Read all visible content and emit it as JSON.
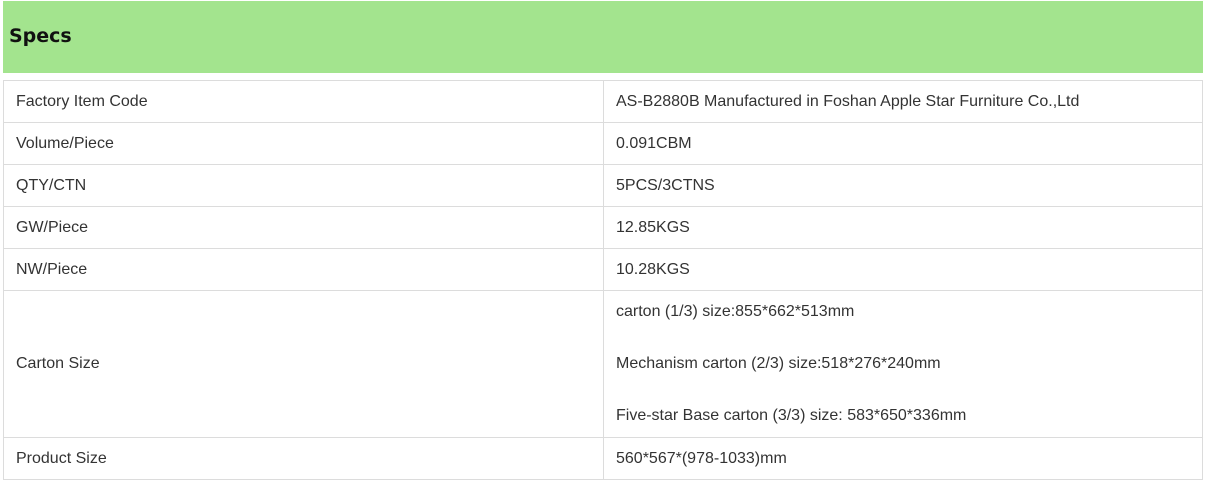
{
  "section": {
    "title": "Specs",
    "header_color": "#a3e48e"
  },
  "specs": [
    {
      "label": "Factory Item Code",
      "values": [
        "AS-B2880B  Manufactured in Foshan Apple Star Furniture Co.,Ltd"
      ]
    },
    {
      "label": "Volume/Piece",
      "values": [
        "0.091CBM"
      ]
    },
    {
      "label": "QTY/CTN",
      "values": [
        "5PCS/3CTNS"
      ]
    },
    {
      "label": "GW/Piece",
      "values": [
        "12.85KGS"
      ]
    },
    {
      "label": "NW/Piece",
      "values": [
        "10.28KGS"
      ]
    },
    {
      "label": "Carton Size",
      "values": [
        "carton (1/3) size:855*662*513mm",
        "Mechanism carton (2/3) size:518*276*240mm",
        "Five-star Base carton (3/3) size: 583*650*336mm"
      ]
    },
    {
      "label": "Product Size",
      "values": [
        "560*567*(978-1033)mm"
      ]
    }
  ]
}
